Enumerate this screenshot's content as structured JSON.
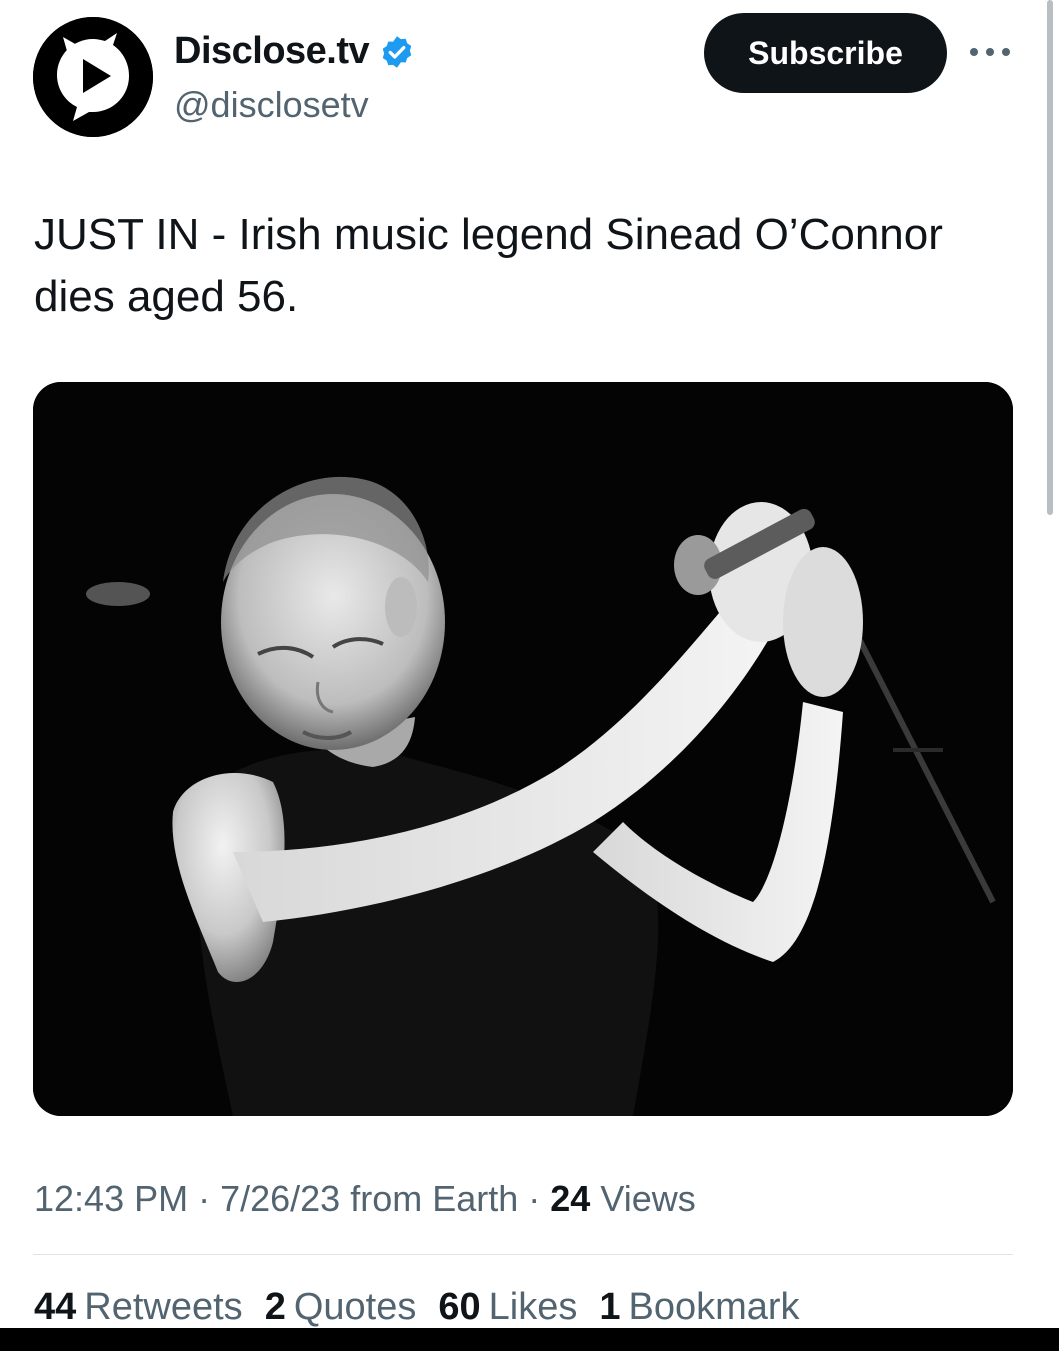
{
  "author": {
    "display_name": "Disclose.tv",
    "handle": "@disclosetv",
    "avatar_icon": "disclose-play-logo-icon",
    "verified_icon": "verified-badge-icon",
    "verified_color": "#1d9bf0"
  },
  "header": {
    "subscribe_label": "Subscribe",
    "more_icon": "more-options-icon"
  },
  "tweet": {
    "text": "JUST IN - Irish music legend Sinead O’Connor dies aged 56.",
    "media_icon": "black-and-white-photo-singer-with-microphone"
  },
  "meta": {
    "time": "12:43 PM",
    "separator1": " · ",
    "date": "7/26/23",
    "source": " from Earth",
    "separator2": " · ",
    "views_count": "24",
    "views_label": " Views"
  },
  "stats": [
    {
      "count": "44",
      "label": "Retweets"
    },
    {
      "count": "2",
      "label": "Quotes"
    },
    {
      "count": "60",
      "label": "Likes"
    },
    {
      "count": "1",
      "label": "Bookmark"
    }
  ]
}
